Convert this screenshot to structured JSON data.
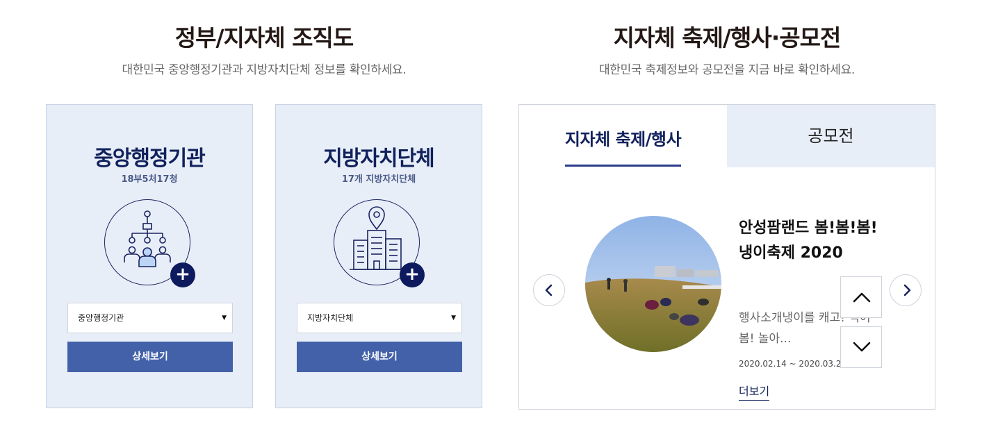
{
  "org_section": {
    "title": "정부/지자체 조직도",
    "subtitle": "대한민국 중앙행정기관과 지방자치단체 정보를 확인하세요.",
    "cards": [
      {
        "title": "중앙행정기관",
        "subtitle": "18부5처17청",
        "icon": "org-chart-icon",
        "select_value": "중앙행정기관",
        "button_label": "상세보기"
      },
      {
        "title": "지방자치단체",
        "subtitle": "17개 지방자치단체",
        "icon": "city-building-icon",
        "select_value": "지방자치단체",
        "button_label": "상세보기"
      }
    ]
  },
  "festival_section": {
    "title": "지자체 축제/행사·공모전",
    "subtitle": "대한민국 축제정보와 공모전을 지금 바로 확인하세요.",
    "tabs": [
      {
        "label": "지자체 축제/행사",
        "active": true
      },
      {
        "label": "공모전",
        "active": false
      }
    ],
    "event": {
      "title": "안성팜랜드 봄!봄!봄! 냉이축제 2020",
      "description": "행사소개냉이를 캐고! 먹어 봄! 놀아...",
      "date": "2020.02.14 ~ 2020.03.22",
      "more_label": "더보기"
    }
  },
  "colors": {
    "navy": "#11215c",
    "button_blue": "#4361a9",
    "card_bg": "#e8eef8"
  }
}
